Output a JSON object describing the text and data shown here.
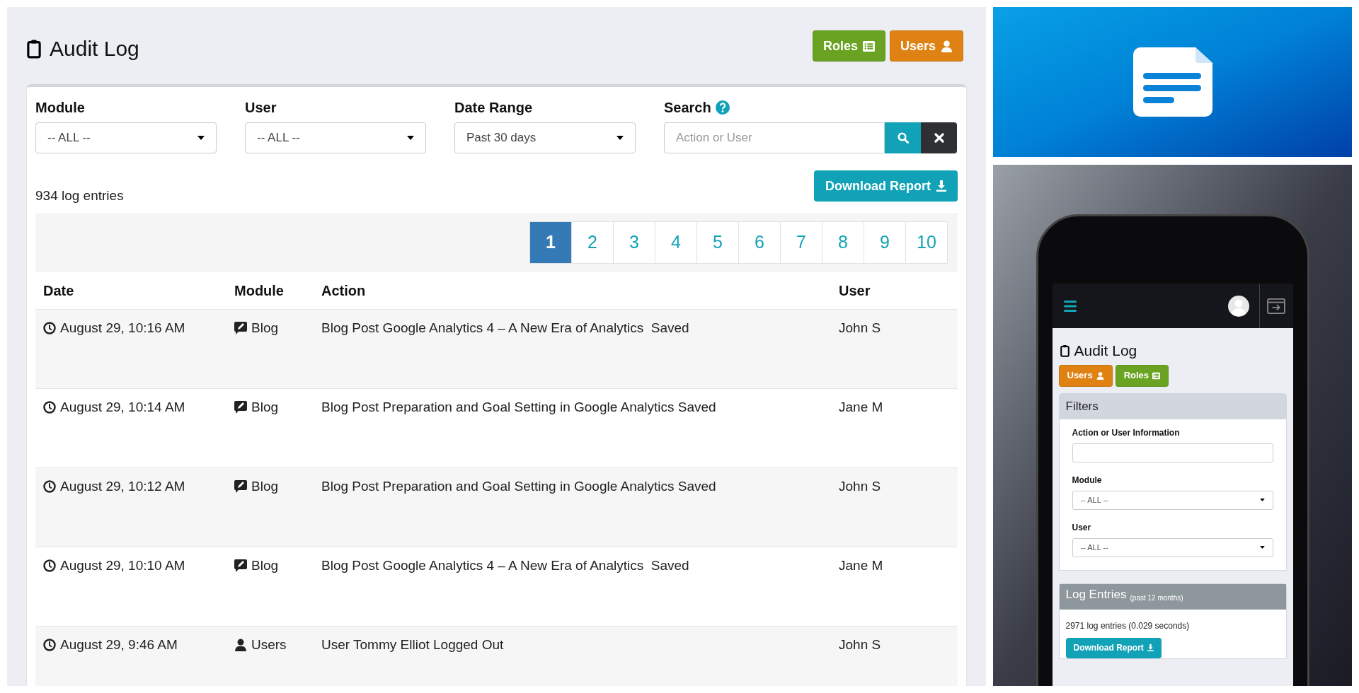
{
  "page": {
    "title": "Audit Log",
    "header_buttons": [
      {
        "label": "Roles",
        "kind": "roles"
      },
      {
        "label": "Users",
        "kind": "users"
      }
    ]
  },
  "filters": [
    {
      "kind": "select",
      "label": "Module",
      "value": "-- ALL --"
    },
    {
      "kind": "select",
      "label": "User",
      "value": "-- ALL --"
    },
    {
      "kind": "select",
      "label": "Date Range",
      "value": "Past 30 days"
    },
    {
      "kind": "search",
      "label": "Search",
      "placeholder": "Action or User"
    }
  ],
  "entry_count": "934 log entries",
  "download_button": "Download Report",
  "pagination": [
    {
      "label": "1",
      "selected": true
    },
    {
      "label": "2",
      "selected": false
    },
    {
      "label": "3",
      "selected": false
    },
    {
      "label": "4",
      "selected": false
    },
    {
      "label": "5",
      "selected": false
    },
    {
      "label": "6",
      "selected": false
    },
    {
      "label": "7",
      "selected": false
    },
    {
      "label": "8",
      "selected": false
    },
    {
      "label": "9",
      "selected": false
    },
    {
      "label": "10",
      "selected": false
    }
  ],
  "table": {
    "columns": [
      "Date",
      "Module",
      "Action",
      "User"
    ],
    "rows": [
      {
        "date": "August 29, 10:16 AM",
        "module": "Blog",
        "kind": "blog",
        "action": "Blog Post Google Analytics 4 – A New Era of Analytics  Saved",
        "user": "John S"
      },
      {
        "date": "August 29, 10:14 AM",
        "module": "Blog",
        "kind": "blog",
        "action": "Blog Post Preparation and Goal Setting in Google Analytics Saved",
        "user": "Jane M"
      },
      {
        "date": "August 29, 10:12 AM",
        "module": "Blog",
        "kind": "blog",
        "action": "Blog Post Preparation and Goal Setting in Google Analytics Saved",
        "user": "John S"
      },
      {
        "date": "August 29, 10:10 AM",
        "module": "Blog",
        "kind": "blog",
        "action": "Blog Post Google Analytics 4 – A New Era of Analytics  Saved",
        "user": "Jane M"
      },
      {
        "date": "August 29, 9:46 AM",
        "module": "Users",
        "kind": "users",
        "action": "User Tommy Elliot Logged Out",
        "user": "John S"
      }
    ]
  },
  "phone": {
    "title": "Audit Log",
    "buttons": [
      {
        "label": "Users",
        "kind": "users"
      },
      {
        "label": "Roles",
        "kind": "roles"
      }
    ],
    "filters_panel": {
      "title": "Filters",
      "fields": [
        {
          "kind": "text",
          "label": "Action or User Information"
        },
        {
          "kind": "select",
          "label": "Module",
          "value": "-- ALL --"
        },
        {
          "kind": "select",
          "label": "User",
          "value": "-- ALL --"
        }
      ]
    },
    "log_panel": {
      "title": "Log Entries",
      "subtitle": "(past 12 months)",
      "count": "2971 log entries (0.029 seconds)",
      "button": "Download Report"
    }
  }
}
